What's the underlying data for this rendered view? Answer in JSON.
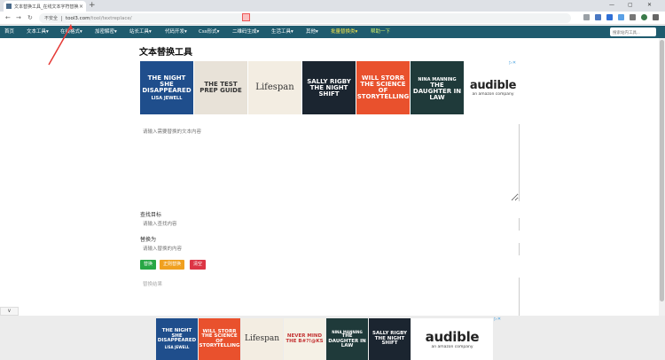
{
  "browser": {
    "tab_title": "文本替换工具_在线文本字符替换工具",
    "close_glyph": "×",
    "new_tab_glyph": "+",
    "back_glyph": "←",
    "forward_glyph": "→",
    "reload_glyph": "↻",
    "security_label": "不安全",
    "url_host": "tool3.com",
    "url_path": "/tool/textreplace/",
    "window_min": "—",
    "window_max": "▢",
    "window_close": "✕"
  },
  "nav": {
    "items": [
      {
        "label": "首页",
        "color": "white"
      },
      {
        "label": "文本工具▾",
        "color": "white"
      },
      {
        "label": "在线格式▾",
        "color": "white"
      },
      {
        "label": "加密解密▾",
        "color": "white"
      },
      {
        "label": "站长工具▾",
        "color": "white"
      },
      {
        "label": "代码开发▾",
        "color": "white"
      },
      {
        "label": "Css形式▾",
        "color": "white"
      },
      {
        "label": "二维码生成▾",
        "color": "white"
      },
      {
        "label": "生活工具▾",
        "color": "white"
      },
      {
        "label": "其他▾",
        "color": "white"
      },
      {
        "label": "批量替换类▾",
        "color": "yellow"
      },
      {
        "label": "帮助一下",
        "color": "green"
      }
    ],
    "search_placeholder": "搜索站内工具..."
  },
  "page": {
    "title": "文本替换工具",
    "ad_marker": "▷✕",
    "textarea_placeholder": "请输入需要替换的文本内容",
    "find_label": "查找目标",
    "find_placeholder": "请输入查找内容",
    "replace_label": "替换为",
    "replace_placeholder": "请输入替换的内容",
    "btn_replace": "替换",
    "btn_regex": "正则替换",
    "btn_clear": "清空",
    "result_placeholder": "替换结果",
    "collapse_glyph": "∨"
  },
  "ads": {
    "top": [
      {
        "title": "THE NIGHT SHE DISAPPEARED",
        "author": "LISA JEWELL",
        "bg": "#1f4e8c",
        "fg": "#ffffff"
      },
      {
        "title": "THE TEST PREP GUIDE",
        "author": "",
        "bg": "#e8e2d8",
        "fg": "#333333"
      },
      {
        "title": "Lifespan",
        "author": "",
        "bg": "#f3ede2",
        "fg": "#333333"
      },
      {
        "title": "SALLY RIGBY THE NIGHT SHIFT",
        "author": "",
        "bg": "#1b2530",
        "fg": "#ffffff"
      },
      {
        "title": "WILL STORR THE SCIENCE OF STORYTELLING",
        "author": "",
        "bg": "#e9512d",
        "fg": "#ffffff"
      },
      {
        "title": "THE DAUGHTER IN LAW",
        "author": "NINA MANNING",
        "bg": "#1f3a3a",
        "fg": "#ffffff"
      }
    ],
    "bottom": [
      {
        "title": "THE NIGHT SHE DISAPPEARED",
        "author": "LISA JEWELL",
        "bg": "#1f4e8c",
        "fg": "#ffffff"
      },
      {
        "title": "WILL STORR THE SCIENCE OF STORYTELLING",
        "author": "",
        "bg": "#e9512d",
        "fg": "#ffffff"
      },
      {
        "title": "Lifespan",
        "author": "",
        "bg": "#f3ede2",
        "fg": "#333333"
      },
      {
        "title": "NEVER MIND THE B#?!@KS",
        "author": "",
        "bg": "#f5f1e6",
        "fg": "#c33333"
      },
      {
        "title": "THE DAUGHTER IN LAW",
        "author": "NINA MANNING",
        "bg": "#1f3a3a",
        "fg": "#ffffff"
      },
      {
        "title": "SALLY RIGBY THE NIGHT SHIFT",
        "author": "",
        "bg": "#1b2530",
        "fg": "#ffffff"
      }
    ],
    "audible_brand": "audible",
    "audible_sub": "an amazon company"
  },
  "colors": {
    "navbar": "#1f5b6e",
    "accent_green": "#28a745",
    "accent_orange": "#f0a020",
    "accent_red": "#dc3545",
    "arrow_red": "#e53935"
  }
}
